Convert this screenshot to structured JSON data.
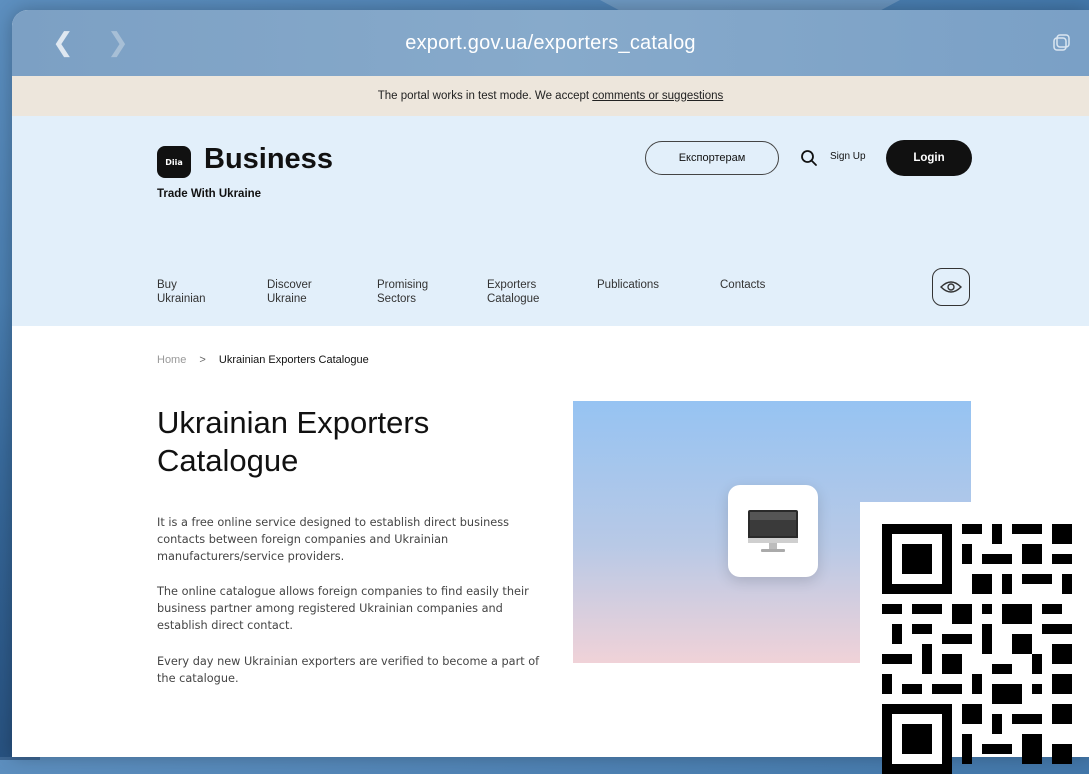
{
  "browser": {
    "url": "export.gov.ua/exporters_catalog",
    "back_icon": "chevron-left-icon",
    "forward_icon": "chevron-right-icon",
    "tabs_icon": "tabs-icon"
  },
  "banner": {
    "text": "The portal works in test mode. We accept ",
    "link": "comments or suggestions"
  },
  "header": {
    "logo_badge": "Diia",
    "logo_title": "Business",
    "logo_subtitle": "Trade With Ukraine",
    "exporters_button": "Експортерам",
    "signup": "Sign Up",
    "login": "Login"
  },
  "nav": {
    "items": [
      {
        "line1": "Buy",
        "line2": "Ukrainian"
      },
      {
        "line1": "Discover",
        "line2": "Ukraine"
      },
      {
        "line1": "Promising",
        "line2": "Sectors"
      },
      {
        "line1": "Exporters",
        "line2": "Catalogue"
      },
      {
        "line1": "",
        "line2": "Publications"
      },
      {
        "line1": "",
        "line2": "Contacts"
      }
    ]
  },
  "breadcrumb": {
    "home": "Home",
    "separator": ">",
    "current": "Ukrainian Exporters Catalogue"
  },
  "main": {
    "title": "Ukrainian Exporters Catalogue",
    "paragraphs": [
      "It is a free online service designed to establish direct business contacts between foreign companies and Ukrainian manufacturers/service providers.",
      "The online catalogue allows foreign companies to find easily their business partner among registered Ukrainian companies and establish direct contact.",
      "Every day new Ukrainian exporters are verified to become a part of the catalogue."
    ]
  }
}
